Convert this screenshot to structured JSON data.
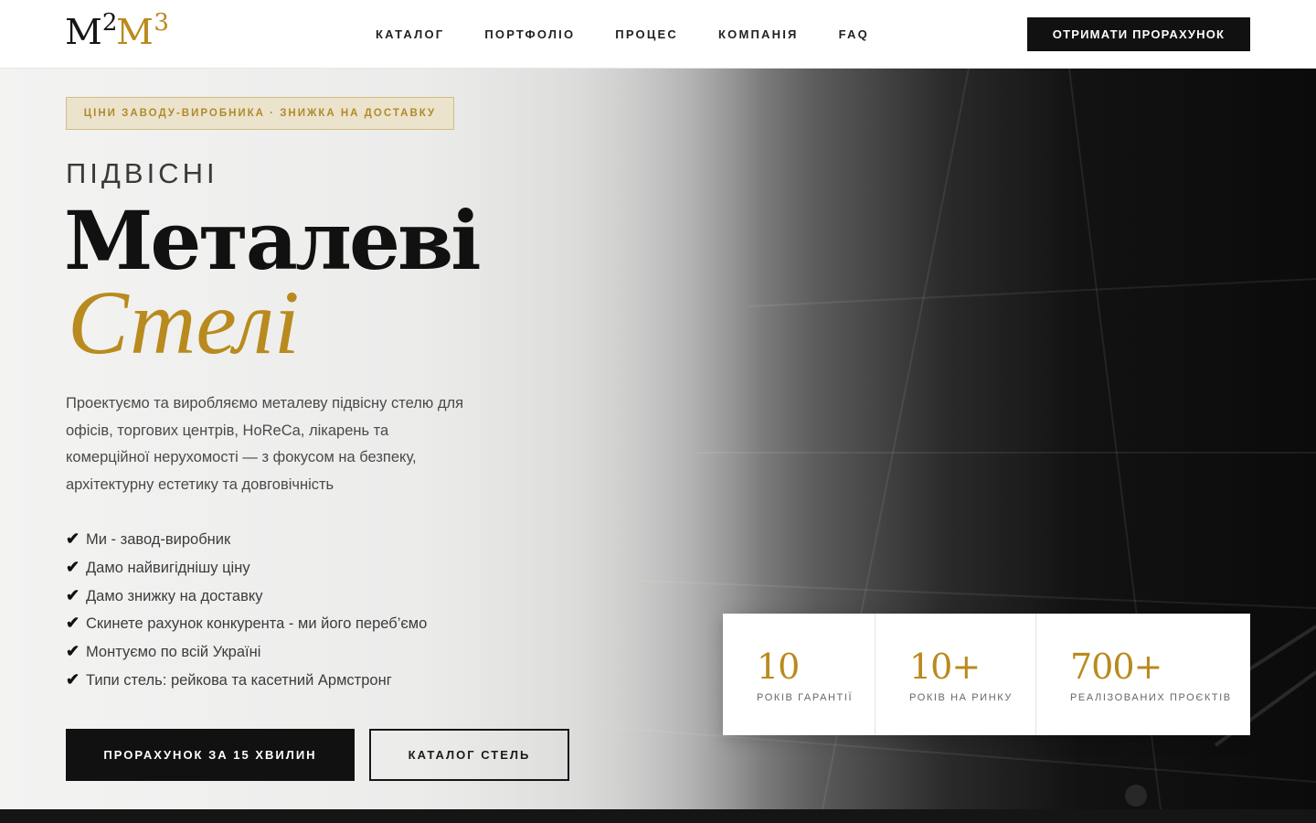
{
  "logo": {
    "m1": "M",
    "sup1": "2",
    "m2": "M",
    "sup2": "3"
  },
  "nav": [
    {
      "label": "КАТАЛОГ"
    },
    {
      "label": "ПОРТФОЛІО"
    },
    {
      "label": "ПРОЦЕС"
    },
    {
      "label": "КОМПАНІЯ"
    },
    {
      "label": "FAQ"
    }
  ],
  "header_cta": "ОТРИМАТИ ПРОРАХУНОК",
  "hero": {
    "badge": "ЦІНИ ЗАВОДУ-ВИРОБНИКА · ЗНИЖКА НА ДОСТАВКУ",
    "kicker": "ПІДВІСНІ",
    "title_main": "Металеві",
    "title_accent": "Стелі",
    "description": "Проектуємо та виробляємо металеву підвісну стелю для офісів, торгових центрів, HoReCa, лікарень та комерційної нерухомості — з фокусом на безпеку, архітектурну естетику та довговічність",
    "features": [
      "Ми - завод-виробник",
      "Дамо найвигіднішу ціну",
      "Дамо знижку на доставку",
      "Скинете рахунок конкурента - ми його переб’ємо",
      "Монтуємо по всій Україні",
      "Типи стель: рейкова та касетний Армстронг"
    ],
    "check_glyph": "✔",
    "primary_button": "ПРОРАХУНОК ЗА 15 ХВИЛИН",
    "secondary_button": "КАТАЛОГ СТЕЛЬ"
  },
  "stats": [
    {
      "value": "10",
      "label": "РОКІВ ГАРАНТІЇ"
    },
    {
      "value": "10+",
      "label": "РОКІВ НА РИНКУ"
    },
    {
      "value": "700+",
      "label": "РЕАЛІЗОВАНИХ ПРОЄКТІВ"
    }
  ],
  "colors": {
    "gold": "#b98a1d",
    "dark": "#111111",
    "badge_bg": "#ece3cc"
  }
}
